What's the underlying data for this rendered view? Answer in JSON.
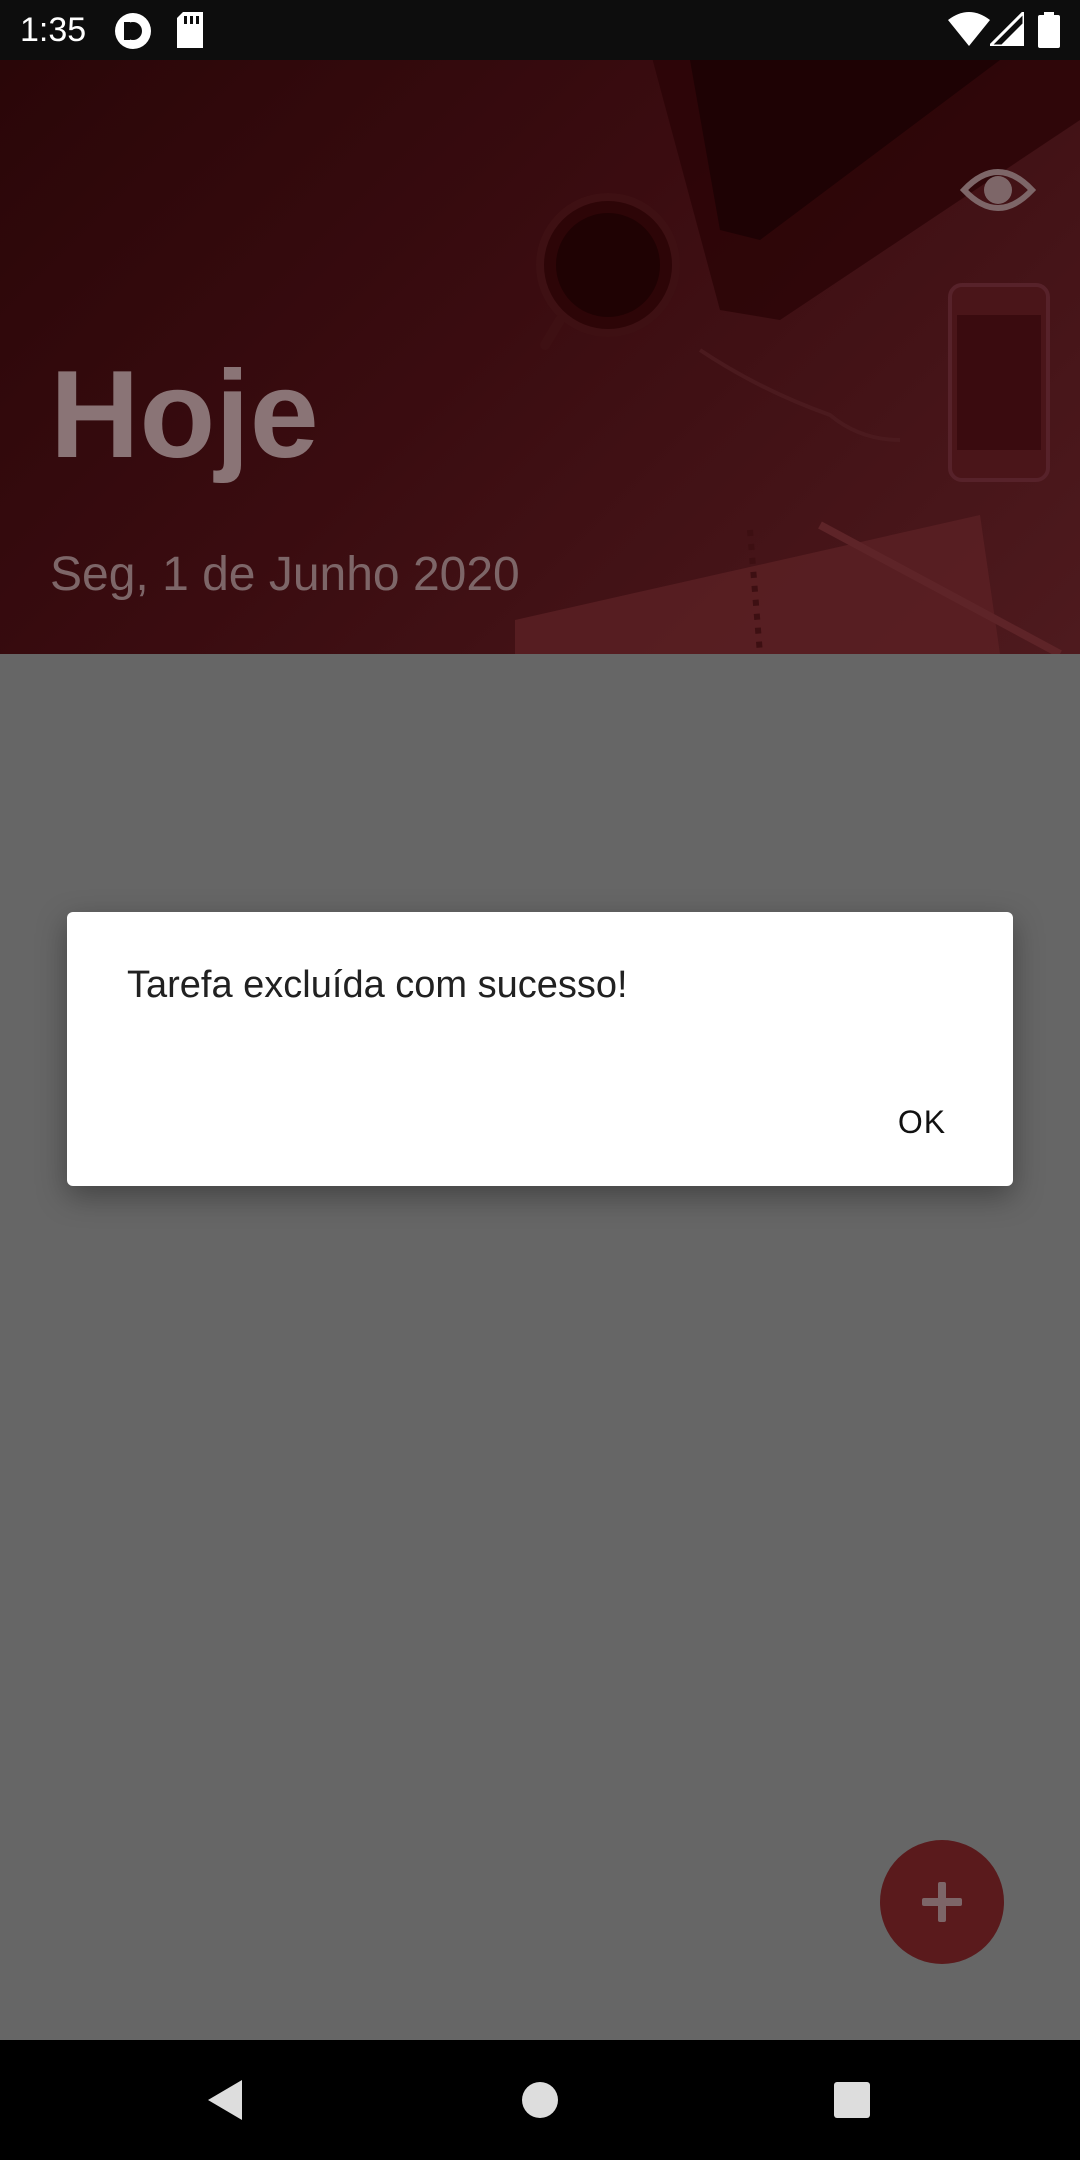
{
  "status_bar": {
    "time": "1:35",
    "icons": [
      "pocket-casts-icon",
      "sd-card-icon",
      "wifi-icon",
      "cell-signal-icon",
      "battery-icon"
    ]
  },
  "header": {
    "title": "Hoje",
    "date": "Seg, 1 de Junho 2020",
    "action_icon": "eye-icon"
  },
  "dialog": {
    "message": "Tarefa excluída com sucesso!",
    "ok_label": "OK"
  },
  "fab": {
    "icon": "plus-icon"
  },
  "nav_bar": {
    "buttons": [
      "back-icon",
      "home-icon",
      "recents-icon"
    ]
  },
  "colors": {
    "header_tint": "#3a0c10",
    "scrim_gray": "#666666",
    "fab": "#5a1a1c",
    "dialog_bg": "#ffffff"
  }
}
